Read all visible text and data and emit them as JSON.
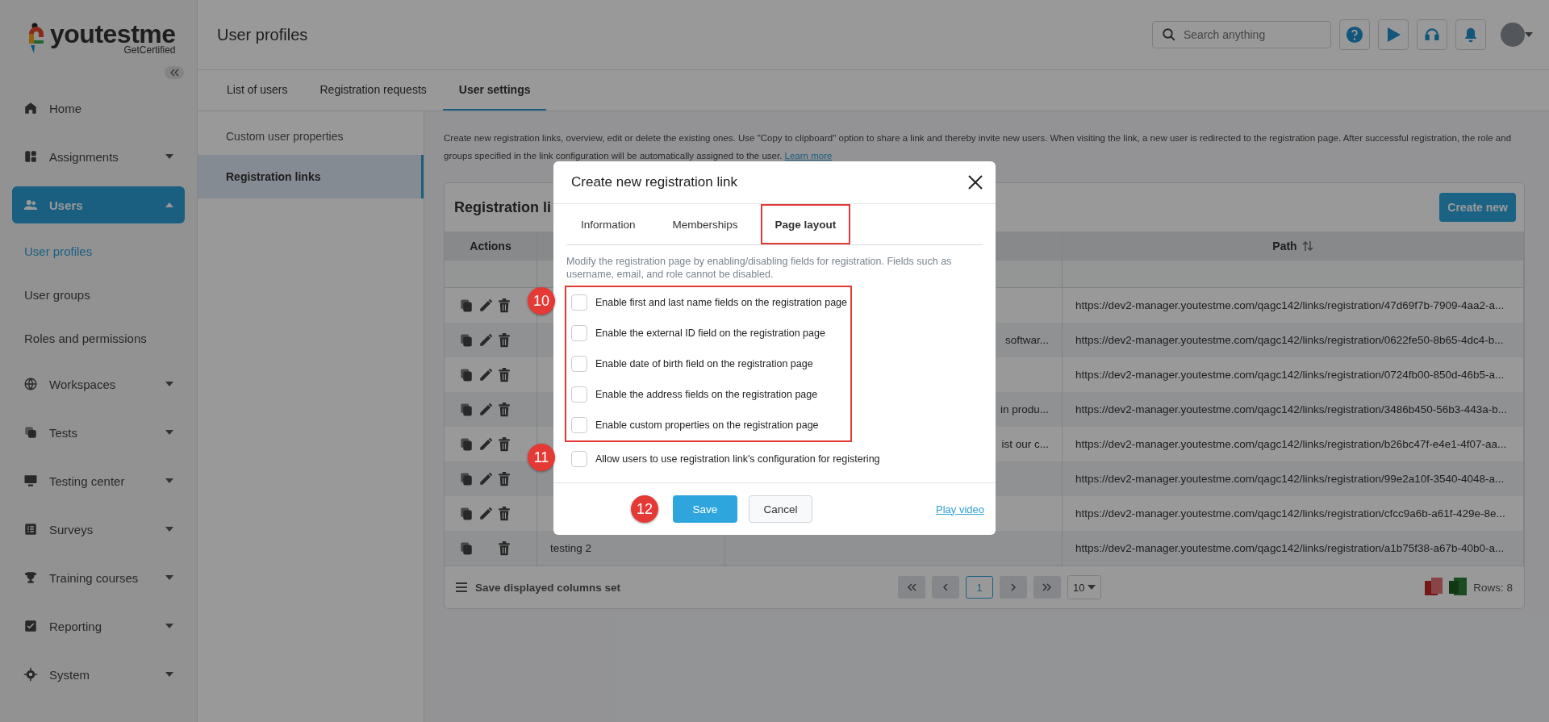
{
  "sidebar": {
    "logo": {
      "name": "youtestme",
      "tagline": "GetCertified"
    },
    "items": [
      {
        "label": "Home"
      },
      {
        "label": "Assignments",
        "expanded": false
      },
      {
        "label": "Users",
        "expanded": true,
        "selected": true,
        "children": [
          {
            "label": "User profiles",
            "selected": true
          },
          {
            "label": "User groups",
            "selected": false
          },
          {
            "label": "Roles and permissions",
            "selected": false
          }
        ]
      },
      {
        "label": "Workspaces",
        "expanded": false
      },
      {
        "label": "Tests",
        "expanded": false
      },
      {
        "label": "Testing center",
        "expanded": false
      },
      {
        "label": "Surveys",
        "expanded": false
      },
      {
        "label": "Training courses",
        "expanded": false
      },
      {
        "label": "Reporting",
        "expanded": false
      },
      {
        "label": "System",
        "expanded": false
      }
    ]
  },
  "header": {
    "title": "User profiles",
    "search": {
      "placeholder": "Search anything"
    }
  },
  "tabs": [
    {
      "label": "List of users",
      "selected": false
    },
    {
      "label": "Registration requests",
      "selected": false
    },
    {
      "label": "User settings",
      "selected": true
    }
  ],
  "subnav": [
    {
      "label": "Custom user properties",
      "selected": false
    },
    {
      "label": "Registration links",
      "selected": true
    }
  ],
  "intro": {
    "text": "Create new registration links, overview, edit or delete the existing ones. Use \"Copy to clipboard\" option to share a link and thereby invite new users. When visiting the link, a new user is redirected to the registration page. After successful registration, the role and groups specified in the link configuration will be automatically assigned to the user.",
    "link": "Learn more"
  },
  "card": {
    "title": "Registration li",
    "create_button": "Create new"
  },
  "table": {
    "columns": {
      "actions": "Actions",
      "path": {
        "label": "Path",
        "sortable": true
      }
    },
    "rows": [
      {
        "editable": true,
        "path": "https://dev2-manager.youtestme.com/qagc142/links/registration/47d69f7b-7909-4aa2-a..."
      },
      {
        "editable": true,
        "description": "softwar...",
        "path": "https://dev2-manager.youtestme.com/qagc142/links/registration/0622fe50-8b65-4dc4-b..."
      },
      {
        "editable": true,
        "path": "https://dev2-manager.youtestme.com/qagc142/links/registration/0724fb00-850d-46b5-a..."
      },
      {
        "editable": true,
        "description": "in produ...",
        "path": "https://dev2-manager.youtestme.com/qagc142/links/registration/3486b450-56b3-443a-b..."
      },
      {
        "editable": true,
        "description": "ist our c...",
        "path": "https://dev2-manager.youtestme.com/qagc142/links/registration/b26bc47f-e4e1-4f07-aa..."
      },
      {
        "editable": true,
        "path": "https://dev2-manager.youtestme.com/qagc142/links/registration/99e2a10f-3540-4048-a..."
      },
      {
        "editable": true,
        "path": "https://dev2-manager.youtestme.com/qagc142/links/registration/cfcc9a6b-a61f-429e-8e..."
      },
      {
        "editable": false,
        "name": "testing 2",
        "path": "https://dev2-manager.youtestme.com/qagc142/links/registration/a1b75f38-a67b-40b0-a..."
      }
    ]
  },
  "footer": {
    "save_columns": "Save displayed columns set",
    "pages": [
      {
        "label": "1",
        "selected": true
      }
    ],
    "page_size": "10",
    "rows": "Rows: 8"
  },
  "modal": {
    "title": "Create new registration link",
    "tabs": [
      {
        "label": "Information",
        "selected": false,
        "highlighted": false
      },
      {
        "label": "Memberships",
        "selected": false,
        "highlighted": false
      },
      {
        "label": "Page layout",
        "selected": true,
        "highlighted": true
      }
    ],
    "note": "Modify the registration page by enabling/disabling fields for registration. Fields such as username, email, and role cannot be disabled.",
    "groups": [
      {
        "highlighted": true,
        "marker": "10",
        "options": [
          {
            "label": "Enable first and last name fields on the registration page",
            "checked": false
          },
          {
            "label": "Enable the external ID field on the registration page",
            "checked": false
          },
          {
            "label": "Enable date of birth field on the registration page",
            "checked": false
          },
          {
            "label": "Enable the address fields on the registration page",
            "checked": false
          },
          {
            "label": "Enable custom properties on the registration page",
            "checked": false
          }
        ]
      },
      {
        "highlighted": false,
        "marker": "11",
        "options": [
          {
            "label": "Allow users to use registration link's configuration for registering",
            "checked": false
          }
        ]
      }
    ],
    "actions": {
      "marker": "12",
      "save": "Save",
      "cancel": "Cancel",
      "video_link": "Play video"
    }
  }
}
